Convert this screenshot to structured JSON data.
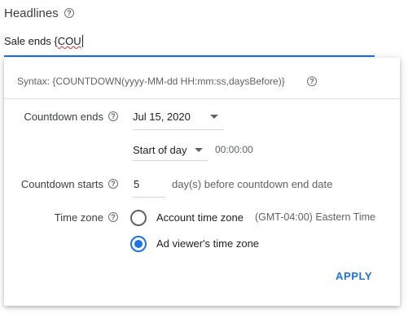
{
  "headline": {
    "label": "Headlines",
    "input_prefix": "Sale ends {",
    "input_misspelled": "COU"
  },
  "panel": {
    "syntax": "Syntax: {COUNTDOWN(yyyy-MM-dd HH:mm:ss,daysBefore)}",
    "countdown_ends": {
      "label": "Countdown ends",
      "date": "Jul 15, 2020",
      "time_mode": "Start of day",
      "time": "00:00:00"
    },
    "countdown_starts": {
      "label": "Countdown starts",
      "days": "5",
      "suffix": "day(s) before countdown end date"
    },
    "time_zone": {
      "label": "Time zone",
      "options": [
        {
          "label": "Account time zone",
          "detail": "(GMT-04:00) Eastern Time",
          "selected": false
        },
        {
          "label": "Ad viewer's time zone",
          "selected": true
        }
      ]
    },
    "apply_label": "APPLY"
  },
  "colors": {
    "accent": "#1a73e8",
    "text": "#3c4043",
    "muted": "#5f6368"
  },
  "icons": [
    "help-icon",
    "dropdown-caret-icon",
    "radio-icon"
  ]
}
